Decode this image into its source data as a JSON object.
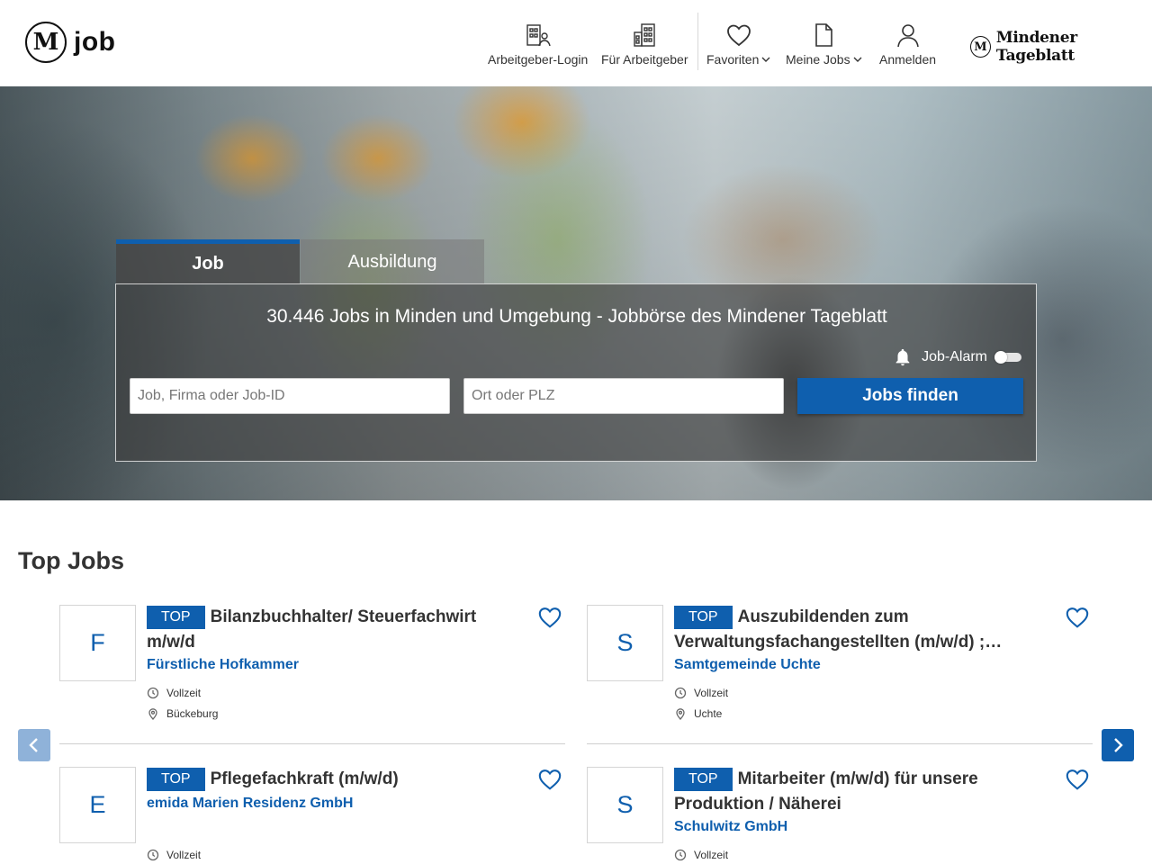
{
  "header": {
    "logo_mark": "M",
    "logo_text": "job",
    "nav": [
      {
        "label": "Arbeitgeber-Login",
        "icon": "employer-login-icon"
      },
      {
        "label": "Für Arbeitgeber",
        "icon": "building-icon"
      },
      {
        "label": "Favoriten",
        "icon": "heart-icon"
      },
      {
        "label": "Meine Jobs",
        "icon": "document-icon"
      },
      {
        "label": "Anmelden",
        "icon": "user-icon"
      }
    ],
    "partner_mark": "M",
    "partner_name": "Mindener Tageblatt"
  },
  "hero": {
    "tabs": [
      "Job",
      "Ausbildung"
    ],
    "headline": "30.446 Jobs in Minden und Umgebung - Jobbörse des Mindener Tageblatt",
    "job_alarm_label": "Job-Alarm",
    "job_placeholder": "Job, Firma oder Job-ID",
    "location_placeholder": "Ort oder PLZ",
    "search_button": "Jobs finden"
  },
  "top_jobs": {
    "title": "Top Jobs",
    "badge": "TOP",
    "cards": [
      {
        "initial": "F",
        "title": "Bilanzbuchhalter/ Steuerfachwirt m/w/d",
        "company": "Fürstliche Hofkammer",
        "type": "Vollzeit",
        "location": "Bückeburg"
      },
      {
        "initial": "S",
        "title": "Auszubildenden zum Verwaltungsfachangestellten (m/w/d) ;…",
        "company": "Samtgemeinde Uchte",
        "type": "Vollzeit",
        "location": "Uchte"
      },
      {
        "initial": "E",
        "title": "Pflegefachkraft (m/w/d)",
        "company": "emida Marien Residenz GmbH",
        "type": "Vollzeit",
        "location": ""
      },
      {
        "initial": "S",
        "title": "Mitarbeiter (m/w/d) für unsere Produktion / Näherei",
        "company": "Schulwitz GmbH",
        "type": "Vollzeit",
        "location": ""
      }
    ]
  },
  "colors": {
    "brand_blue": "#0f5fae",
    "arrow_disabled": "#8fb2d9"
  }
}
